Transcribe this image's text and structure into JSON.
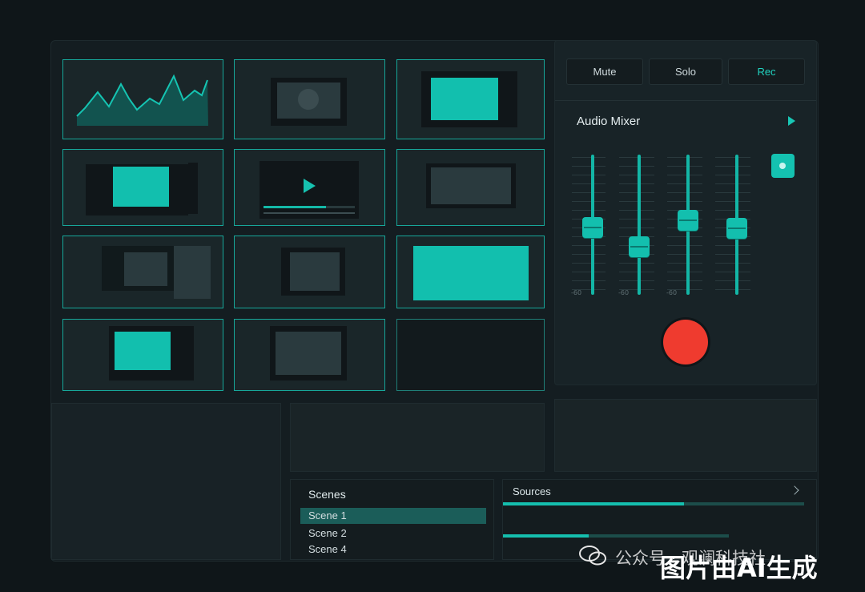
{
  "toolbar": {
    "mute_label": "Mute",
    "solo_label": "Solo",
    "rec_label": "Rec"
  },
  "mixer": {
    "title": "Audio Mixer",
    "scale_labels": [
      "-60",
      "-60",
      "-60"
    ],
    "channel_levels": [
      0.52,
      0.36,
      0.57,
      0.5
    ]
  },
  "scenes": {
    "title": "Scenes",
    "items": [
      "Scene 1",
      "Scene 2",
      "Scene 4"
    ],
    "selected_index": 0
  },
  "sources": {
    "title": "Sources",
    "progress": [
      0.6,
      0.38
    ]
  },
  "watermark": {
    "line1": "公众号 · 观澜科技社",
    "line2": "图片由AI生成"
  },
  "colors": {
    "accent": "#13bfae",
    "record": "#ef3b2f",
    "background": "#0f1619"
  }
}
